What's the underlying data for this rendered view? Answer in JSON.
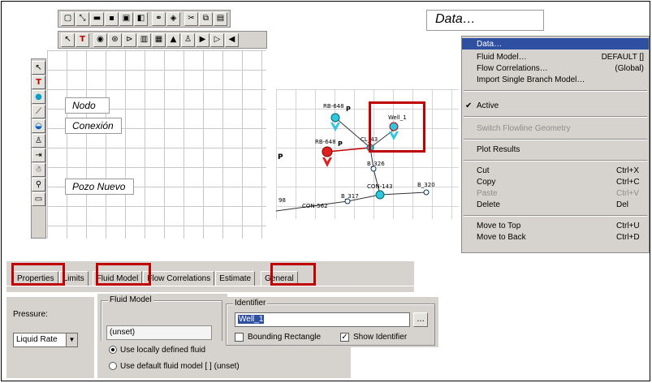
{
  "callouts": {
    "data": "Data…",
    "nodo": "Nodo",
    "conexion": "Conexión",
    "pozo_nuevo": "Pozo Nuevo"
  },
  "toolbar_icons": [
    "new-icon",
    "cut-icon",
    "open-icon",
    "save-icon",
    "print-icon",
    "export-icon",
    "find-icon",
    "help-icon",
    "scissors-icon",
    "copy-icon",
    "paste-icon"
  ],
  "palette_icons": [
    "pointer-icon",
    "text-icon",
    "node-icon",
    "connection-icon",
    "zoom-icon",
    "well-icon",
    "source-icon",
    "man-icon",
    "sink-icon",
    "box-icon"
  ],
  "network": {
    "labels": [
      "RB-648",
      "Well_1",
      "RB-648",
      "CL_43",
      "B_326",
      "CON-143",
      "B_320",
      "B_317",
      "CON-562",
      "98"
    ]
  },
  "context_menu": {
    "items": [
      {
        "label": "Data…",
        "accel": "",
        "state": "selected"
      },
      {
        "label": "Fluid Model…",
        "accel": "DEFAULT []",
        "state": "enabled"
      },
      {
        "label": "Flow Correlations…",
        "accel": "(Global)",
        "state": "enabled"
      },
      {
        "label": "Import Single Branch Model…",
        "accel": "",
        "state": "enabled"
      },
      {
        "label": "Active",
        "accel": "",
        "state": "checked"
      },
      {
        "label": "Switch Flowline Geometry",
        "accel": "",
        "state": "disabled"
      },
      {
        "label": "Plot Results",
        "accel": "",
        "state": "enabled"
      },
      {
        "label": "Cut",
        "accel": "Ctrl+X",
        "state": "enabled"
      },
      {
        "label": "Copy",
        "accel": "Ctrl+C",
        "state": "enabled"
      },
      {
        "label": "Paste",
        "accel": "Ctrl+V",
        "state": "disabled"
      },
      {
        "label": "Delete",
        "accel": "Del",
        "state": "enabled"
      },
      {
        "label": "Move to Top",
        "accel": "Ctrl+U",
        "state": "enabled"
      },
      {
        "label": "Move to Back",
        "accel": "Ctrl+D",
        "state": "enabled"
      }
    ]
  },
  "tabs": [
    "Properties",
    "Limits",
    "Fluid Model",
    "Flow Correlations",
    "Estimate",
    "General"
  ],
  "dialog": {
    "pressure_label": "Pressure:",
    "rate_select": "Liquid Rate",
    "fluid_model_group": "Fluid Model",
    "fluid_model_value": "(unset)",
    "radio_local": "Use locally defined fluid",
    "radio_default": "Use default fluid model [ ] (unset)",
    "identifier_group": "Identifier",
    "identifier_value": "Well_1",
    "browse_button": "...",
    "bounding_rectangle": "Bounding Rectangle",
    "show_identifier": "Show Identifier"
  },
  "colors": {
    "highlight_red": "#c00000",
    "menu_selected": "#2f4fa0",
    "node_cyan": "#2ec7e0",
    "well_red": "#e02020"
  }
}
